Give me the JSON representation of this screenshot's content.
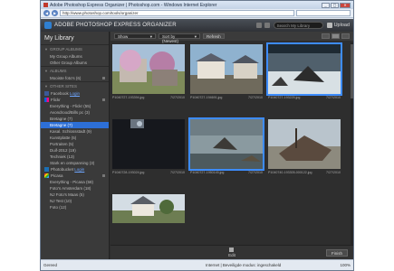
{
  "browser": {
    "title": "Adobe Photoshop Express Organizer | Photoshop.com - Windows Internet Explorer",
    "url": "http://www.photoshop.com/tools/organizer",
    "status_left": "Gereed",
    "status_mid": "Internet | Beveiligde modus: ingeschakeld",
    "zoom": "100%"
  },
  "app": {
    "title": "ADOBE PHOTOSHOP EXPRESS ORGANIZER",
    "search_placeholder": "Search My Library",
    "upload_label": "Upload"
  },
  "sidebar": {
    "title": "My Library",
    "group_albums_header": "GROUP ALBUMS",
    "group_albums_items": [
      "My Group Albums",
      "Other Group Albums"
    ],
    "albums_header": "ALBUMS",
    "albums_items": [
      "Mooiste foto's (6)"
    ],
    "other_sites_header": "OTHER SITES",
    "facebook": {
      "name": "Facebook",
      "login": "Login"
    },
    "flickr": {
      "name": "Flickr"
    },
    "flickr_items": [
      "Everything - Flickr (55)",
      "Avondrood/Bills pc (3)",
      "Bretagne (7)",
      "Bretagne (7)",
      "Kasal. Schlossstadt (9)",
      "Kunstplatte (5)",
      "Portraiten (5)",
      "Duif-2012 (19)",
      "Techniek (13)",
      "Stark en ontspanning (3)"
    ],
    "photobucket": {
      "name": "Photobucket",
      "login": "Login"
    },
    "picasa": {
      "name": "Picasa"
    },
    "picasa_items": [
      "Everything - Picasa (58)",
      "Foto's Amsterdam (18)",
      "NJ Foto's Maas (5)",
      "NJ Test (10)",
      "Foto (12)"
    ]
  },
  "toolbar": {
    "show_label": "Show",
    "sort_label": "Sort by (Newest)",
    "refresh_label": "Refresh"
  },
  "photos": [
    {
      "file": "P1040727-193394.jpg",
      "date": "7/27/2010"
    },
    {
      "file": "P1040727-194691.jpg",
      "date": "7/27/2010"
    },
    {
      "file": "P1040727-193225.jpg",
      "date": "7/27/2010"
    },
    {
      "file": "P1040728-193024.jpg",
      "date": "7/27/2010"
    },
    {
      "file": "P1040727-1950145.jpg",
      "date": "7/27/2010"
    },
    {
      "file": "P1040740-193305-000122.jpg",
      "date": "7/27/2010"
    },
    {
      "file": "",
      "date": ""
    }
  ],
  "bottom": {
    "edit_label": "Edit",
    "finish_label": "Finish"
  }
}
